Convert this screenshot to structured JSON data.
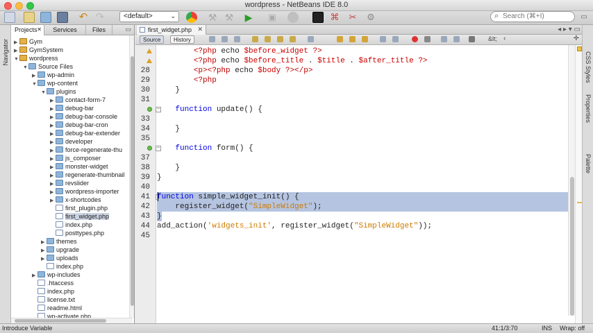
{
  "window": {
    "title": "wordpress - NetBeans IDE 8.0"
  },
  "toolbar": {
    "config_value": "<default>",
    "search_placeholder": "Search (⌘+I)"
  },
  "left_strip": {
    "navigator_label": "Navigator"
  },
  "projects_panel": {
    "tabs": [
      {
        "label": "Projects",
        "active": true,
        "close": "✕"
      },
      {
        "label": "Services",
        "active": false
      },
      {
        "label": "Files",
        "active": false
      }
    ],
    "tree": [
      {
        "label": "Gym",
        "depth": 0,
        "kind": "project",
        "expanded": false
      },
      {
        "label": "GymSystem",
        "depth": 0,
        "kind": "project",
        "expanded": false
      },
      {
        "label": "wordpress",
        "depth": 0,
        "kind": "project",
        "expanded": true
      },
      {
        "label": "Source Files",
        "depth": 1,
        "kind": "folder",
        "expanded": true
      },
      {
        "label": "wp-admin",
        "depth": 2,
        "kind": "folder",
        "expanded": false
      },
      {
        "label": "wp-content",
        "depth": 2,
        "kind": "folder",
        "expanded": true
      },
      {
        "label": "plugins",
        "depth": 3,
        "kind": "folder",
        "expanded": true
      },
      {
        "label": "contact-form-7",
        "depth": 4,
        "kind": "folder",
        "expanded": false
      },
      {
        "label": "debug-bar",
        "depth": 4,
        "kind": "folder",
        "expanded": false
      },
      {
        "label": "debug-bar-console",
        "depth": 4,
        "kind": "folder",
        "expanded": false
      },
      {
        "label": "debug-bar-cron",
        "depth": 4,
        "kind": "folder",
        "expanded": false
      },
      {
        "label": "debug-bar-extender",
        "depth": 4,
        "kind": "folder",
        "expanded": false
      },
      {
        "label": "developer",
        "depth": 4,
        "kind": "folder",
        "expanded": false
      },
      {
        "label": "force-regenerate-thu",
        "depth": 4,
        "kind": "folder",
        "expanded": false
      },
      {
        "label": "js_composer",
        "depth": 4,
        "kind": "folder",
        "expanded": false
      },
      {
        "label": "monster-widget",
        "depth": 4,
        "kind": "folder",
        "expanded": false
      },
      {
        "label": "regenerate-thumbnail",
        "depth": 4,
        "kind": "folder",
        "expanded": false
      },
      {
        "label": "revslider",
        "depth": 4,
        "kind": "folder",
        "expanded": false
      },
      {
        "label": "wordpress-importer",
        "depth": 4,
        "kind": "folder",
        "expanded": false
      },
      {
        "label": "x-shortcodes",
        "depth": 4,
        "kind": "folder",
        "expanded": false
      },
      {
        "label": "first_plugin.php",
        "depth": 4,
        "kind": "file",
        "expanded": null
      },
      {
        "label": "first_widget.php",
        "depth": 4,
        "kind": "file",
        "expanded": null,
        "selected": true
      },
      {
        "label": "index.php",
        "depth": 4,
        "kind": "file",
        "expanded": null
      },
      {
        "label": "posttypes.php",
        "depth": 4,
        "kind": "file",
        "expanded": null
      },
      {
        "label": "themes",
        "depth": 3,
        "kind": "folder",
        "expanded": false
      },
      {
        "label": "upgrade",
        "depth": 3,
        "kind": "folder",
        "expanded": false
      },
      {
        "label": "uploads",
        "depth": 3,
        "kind": "folder",
        "expanded": false
      },
      {
        "label": "index.php",
        "depth": 3,
        "kind": "file",
        "expanded": null
      },
      {
        "label": "wp-includes",
        "depth": 2,
        "kind": "folder",
        "expanded": false
      },
      {
        "label": ".htaccess",
        "depth": 2,
        "kind": "file",
        "expanded": null
      },
      {
        "label": "index.php",
        "depth": 2,
        "kind": "file",
        "expanded": null
      },
      {
        "label": "license.txt",
        "depth": 2,
        "kind": "file",
        "expanded": null
      },
      {
        "label": "readme.html",
        "depth": 2,
        "kind": "file",
        "expanded": null
      },
      {
        "label": "wp-activate.php",
        "depth": 2,
        "kind": "file",
        "expanded": null
      }
    ]
  },
  "editor": {
    "tab_label": "first_widget.php",
    "tab_close": "✕",
    "source_label": "Source",
    "history_label": "History",
    "extra_glyphs": "&lt;",
    "lines": [
      {
        "n": "",
        "gutter": "warn",
        "tokens": [
          [
            "p",
            "        "
          ],
          [
            "tg",
            "<?php "
          ],
          [
            "p",
            "echo "
          ],
          [
            "vr",
            "$before_widget "
          ],
          [
            "tg",
            "?>"
          ]
        ]
      },
      {
        "n": "",
        "gutter": "warn",
        "tokens": [
          [
            "p",
            "        "
          ],
          [
            "tg",
            "<?php "
          ],
          [
            "p",
            "echo "
          ],
          [
            "vr",
            "$before_title"
          ],
          [
            "p",
            " . "
          ],
          [
            "vr",
            "$title"
          ],
          [
            "p",
            " . "
          ],
          [
            "vr",
            "$after_title "
          ],
          [
            "tg",
            "?>"
          ]
        ]
      },
      {
        "n": "28",
        "tokens": [
          [
            "p",
            "        "
          ],
          [
            "tg",
            "<p><?php "
          ],
          [
            "p",
            "echo "
          ],
          [
            "vr",
            "$body "
          ],
          [
            "tg",
            "?></p>"
          ]
        ]
      },
      {
        "n": "29",
        "tokens": [
          [
            "p",
            "        "
          ],
          [
            "tg",
            "<?php"
          ]
        ]
      },
      {
        "n": "30",
        "tokens": [
          [
            "p",
            "    }"
          ]
        ]
      },
      {
        "n": "31",
        "tokens": [
          [
            "p",
            ""
          ]
        ]
      },
      {
        "n": "",
        "gutter": "override",
        "fold": true,
        "tokens": [
          [
            "p",
            "    "
          ],
          [
            "kw",
            "function"
          ],
          [
            "p",
            " update() {"
          ]
        ]
      },
      {
        "n": "33",
        "tokens": [
          [
            "p",
            ""
          ]
        ]
      },
      {
        "n": "34",
        "tokens": [
          [
            "p",
            "    }"
          ]
        ]
      },
      {
        "n": "35",
        "tokens": [
          [
            "p",
            ""
          ]
        ]
      },
      {
        "n": "",
        "gutter": "override",
        "fold": true,
        "tokens": [
          [
            "p",
            "    "
          ],
          [
            "kw",
            "function"
          ],
          [
            "p",
            " form() {"
          ]
        ]
      },
      {
        "n": "37",
        "tokens": [
          [
            "p",
            ""
          ]
        ]
      },
      {
        "n": "38",
        "tokens": [
          [
            "p",
            "    }"
          ]
        ]
      },
      {
        "n": "39",
        "tokens": [
          [
            "p",
            "}"
          ]
        ]
      },
      {
        "n": "40",
        "tokens": [
          [
            "p",
            ""
          ]
        ]
      },
      {
        "n": "41",
        "fold": true,
        "selected": true,
        "tokens": [
          [
            "kw",
            "function"
          ],
          [
            "p",
            " simple_widget_init() {"
          ]
        ]
      },
      {
        "n": "42",
        "selected": true,
        "tokens": [
          [
            "p",
            "    register_widget("
          ],
          [
            "st",
            "\"SimpleWidget\""
          ],
          [
            "p",
            ");"
          ]
        ]
      },
      {
        "n": "43",
        "selected": "partial",
        "tokens": [
          [
            "p",
            "}"
          ]
        ]
      },
      {
        "n": "44",
        "tokens": [
          [
            "p",
            "add_action("
          ],
          [
            "st",
            "'widgets_init'"
          ],
          [
            "p",
            ", register_widget("
          ],
          [
            "st",
            "\"SimpleWidget\""
          ],
          [
            "p",
            "));"
          ]
        ]
      },
      {
        "n": "45",
        "tokens": [
          [
            "p",
            ""
          ]
        ]
      }
    ]
  },
  "right_strip": {
    "labels": [
      "CSS Styles",
      "Properties",
      "Palette"
    ]
  },
  "status_bar": {
    "hint": "Introduce Variable",
    "position": "41:1/3:70",
    "mode": "INS",
    "wrap": "Wrap: off"
  },
  "colors": {
    "selection": "#b5c4e0",
    "keyword": "#0000e6",
    "string": "#ce7b00",
    "variable": "#cc0000"
  }
}
